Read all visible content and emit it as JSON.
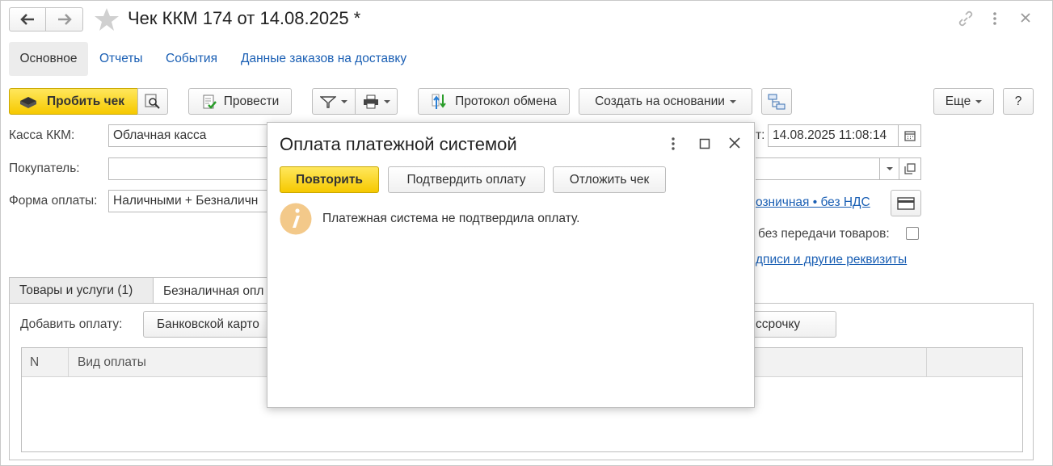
{
  "window": {
    "title": "Чек ККМ 174 от 14.08.2025 *"
  },
  "sections": [
    {
      "label": "Основное"
    },
    {
      "label": "Отчеты"
    },
    {
      "label": "События"
    },
    {
      "label": "Данные заказов на доставку"
    }
  ],
  "toolbar": {
    "print_check": "Пробить чек",
    "post": "Провести",
    "exchange_log": "Протокол обмена",
    "create_based": "Создать на основании",
    "more": "Еще",
    "help": "?"
  },
  "form": {
    "cash_register_label": "Касса ККМ:",
    "cash_register_value": "Облачная касса",
    "date_label_tail": "т:",
    "date_value": "14.08.2025 11:08:14",
    "buyer_label": "Покупатель:",
    "buyer_value": "",
    "payment_form_label": "Форма оплаты:",
    "payment_form_value": "Наличными + Безналичн",
    "price_type_link": "озничная • без НДС",
    "no_goods_transfer_label": "без передачи товаров:",
    "signatures_link": "дписи и другие реквизиты"
  },
  "tabs": [
    {
      "label": "Товары и услуги (1)"
    },
    {
      "label": "Безналичная опл"
    }
  ],
  "payments_tab": {
    "add_payment_label": "Добавить оплату:",
    "bank_card_button": "Банковской карто",
    "installment_button": "ссрочку",
    "columns": [
      "N",
      "Вид оплаты"
    ]
  },
  "dialog": {
    "title": "Оплата платежной системой",
    "retry_button": "Повторить",
    "confirm_button": "Подтвердить оплату",
    "postpone_button": "Отложить чек",
    "message": "Платежная система не подтвердила оплату."
  },
  "colors": {
    "accent_yellow": "#f6c900",
    "link_blue": "#1a5fb4",
    "info_icon": "#f3c98a"
  }
}
